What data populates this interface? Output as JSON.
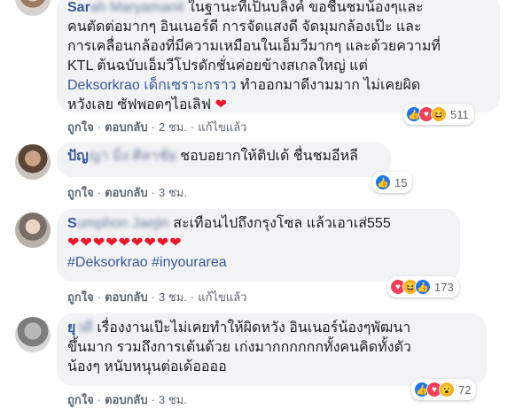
{
  "comments": [
    {
      "author_visible": "Sar",
      "author_blurred": "ah Maryamanit",
      "lines": [
        "ในฐานะที่เป็นบลิงค์ ขอชื่นชมน้องๆและ",
        "คนตัดต่อมากๆ อินเนอร์ดี การจัดแสงดี จัดมุมกล้องเป๊ะ และ",
        "การเคลื่อนกล้องที่มีความเหมือนในเอ็มวีมากๆ และด้วยความที่",
        "KTL ต้นฉบับเอ็มวีโปรดักชั่นค่อยข้างสเกลใหญ่ แต่"
      ],
      "mention": "Deksorkrao เด็กเซราะกราว",
      "line5_rest": " ทำออกมาดีงามมาก ไม่เคยผิด",
      "line6": "หวังเลย ซัฟพอดๆไอเลิฟ",
      "heart": "❤",
      "actions": {
        "like": "ถูกใจ",
        "reply": "ตอบกลับ",
        "time": "2 ชม.",
        "edited": "แก้ไขแล้ว"
      },
      "reactions": {
        "icons": [
          "like-icon",
          "love-icon",
          "haha-icon"
        ],
        "count": "511"
      }
    },
    {
      "author_visible": "ปัญ",
      "author_blurred": "ญา มิ่ง ศิลาชัย",
      "text": "ชอบอยากให้ติปเด้ ชื่นชมอีหลี",
      "actions": {
        "like": "ถูกใจ",
        "reply": "ตอบกลับ",
        "time": "3 ชม."
      },
      "reactions": {
        "icons": [
          "like-icon"
        ],
        "count": "15"
      }
    },
    {
      "author_visible": "S",
      "author_blurred": "umphon Jaejin",
      "text": "สะเทือนไปถึงกรุงโซล แล้วเอาเส่555",
      "hearts": "❤❤❤❤❤❤❤❤❤",
      "hashtags": "#Deksorkrao #inyourarea",
      "actions": {
        "like": "ถูกใจ",
        "reply": "ตอบกลับ",
        "time": "3 ชม.",
        "edited": "แก้ไขแล้ว"
      },
      "reactions": {
        "icons": [
          "love-icon",
          "haha-icon",
          "like-icon"
        ],
        "count": "173"
      }
    },
    {
      "author_visible": "ยุ",
      "author_blurred": "วดี",
      "text_line1": "เรื่องงานเป๊ะไม่เคยทำให้ผิดหวัง อินเนอร์น้องๆพัฒนา",
      "text_line2": "ขึ้นมาก รวมถึงการเต้นด้วย เก่งมากกกกกกทั้งคนคิดทั้งตัว",
      "text_line3": "น้องๆ หนับหนุนต่อเด้ออออ",
      "actions": {
        "like": "ถูกใจ",
        "reply": "ตอบกลับ",
        "time": "3 ชม."
      },
      "reactions": {
        "icons": [
          "like-icon",
          "love-icon",
          "wow-icon"
        ],
        "count": "72"
      }
    }
  ],
  "glyphs": {
    "like": "👍",
    "love": "♥",
    "haha": "😆",
    "wow": "😮",
    "dot": "·"
  }
}
